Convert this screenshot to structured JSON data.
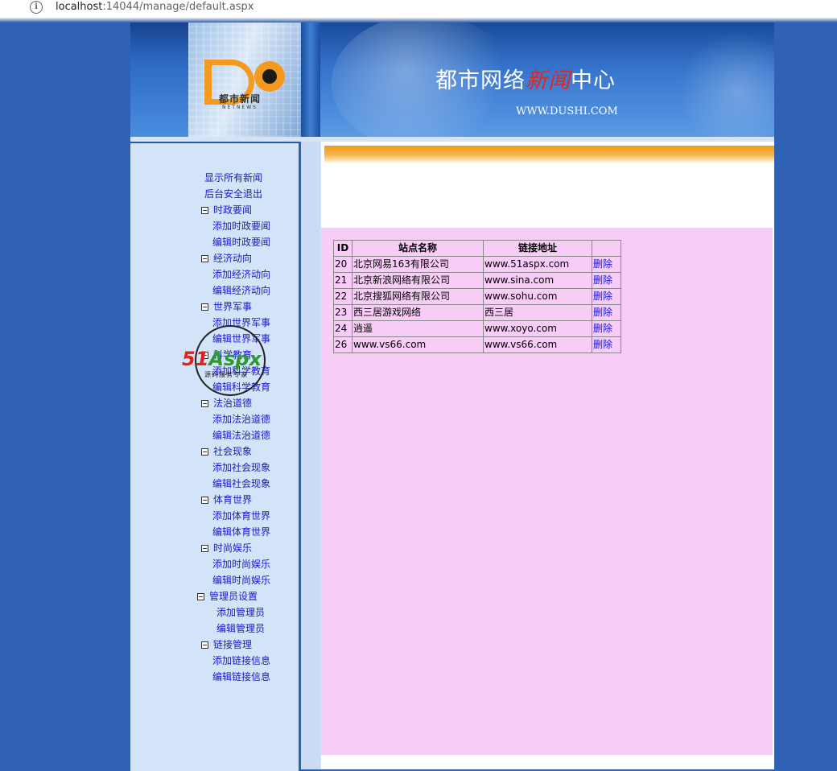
{
  "browser": {
    "url_host": "localhost",
    "url_rest": ":14044/manage/default.aspx"
  },
  "banner": {
    "logo_text": "都市新闻",
    "logo_sub": "NETNEWS",
    "title_a": "都市网络",
    "title_red": "新闻",
    "title_b": "中心",
    "site_url": "WWW.DUSHI.COM"
  },
  "nav": {
    "items": [
      {
        "label": "显示所有新闻",
        "level": "l0",
        "toggle": false
      },
      {
        "label": "后台安全退出",
        "level": "l0",
        "toggle": false
      },
      {
        "label": "时政要闻",
        "level": "l1",
        "toggle": true
      },
      {
        "label": "添加时政要闻",
        "level": "l2",
        "toggle": false
      },
      {
        "label": "编辑时政要闻",
        "level": "l2",
        "toggle": false
      },
      {
        "label": "经济动向",
        "level": "l1",
        "toggle": true
      },
      {
        "label": "添加经济动向",
        "level": "l2",
        "toggle": false
      },
      {
        "label": "编辑经济动向",
        "level": "l2",
        "toggle": false
      },
      {
        "label": "世界军事",
        "level": "l1",
        "toggle": true
      },
      {
        "label": "添加世界军事",
        "level": "l2",
        "toggle": false
      },
      {
        "label": "编辑世界军事",
        "level": "l2",
        "toggle": false
      },
      {
        "label": "科学教育",
        "level": "l1",
        "toggle": true
      },
      {
        "label": "添加科学教育",
        "level": "l2",
        "toggle": false
      },
      {
        "label": "编辑科学教育",
        "level": "l2",
        "toggle": false
      },
      {
        "label": "法治道德",
        "level": "l1",
        "toggle": true
      },
      {
        "label": "添加法治道德",
        "level": "l2",
        "toggle": false
      },
      {
        "label": "编辑法治道德",
        "level": "l2",
        "toggle": false
      },
      {
        "label": "社会现象",
        "level": "l1",
        "toggle": true
      },
      {
        "label": "添加社会现象",
        "level": "l2",
        "toggle": false
      },
      {
        "label": "编辑社会现象",
        "level": "l2",
        "toggle": false
      },
      {
        "label": "体育世界",
        "level": "l1",
        "toggle": true
      },
      {
        "label": "添加体育世界",
        "level": "l2",
        "toggle": false
      },
      {
        "label": "编辑体育世界",
        "level": "l2",
        "toggle": false
      },
      {
        "label": "时尚娱乐",
        "level": "l1",
        "toggle": true
      },
      {
        "label": "添加时尚娱乐",
        "level": "l2",
        "toggle": false
      },
      {
        "label": "编辑时尚娱乐",
        "level": "l2",
        "toggle": false
      },
      {
        "label": "管理员设置",
        "level": "l1a",
        "toggle": true
      },
      {
        "label": "添加管理员",
        "level": "l2a",
        "toggle": false
      },
      {
        "label": "编辑管理员",
        "level": "l2a",
        "toggle": false
      },
      {
        "label": "链接管理",
        "level": "l1",
        "toggle": true
      },
      {
        "label": "添加链接信息",
        "level": "l2",
        "toggle": false
      },
      {
        "label": "编辑链接信息",
        "level": "l2",
        "toggle": false
      }
    ]
  },
  "table": {
    "headers": [
      "ID",
      "站点名称",
      "链接地址",
      ""
    ],
    "rows": [
      {
        "id": "20",
        "name": "北京网易163有限公司",
        "url": "www.51aspx.com",
        "action": "删除"
      },
      {
        "id": "21",
        "name": "北京新浪网络有限公司",
        "url": "www.sina.com",
        "action": "删除"
      },
      {
        "id": "22",
        "name": "北京搜狐网络有限公司",
        "url": "www.sohu.com",
        "action": "删除"
      },
      {
        "id": "23",
        "name": "西三居游戏网络",
        "url": "西三居",
        "action": "删除"
      },
      {
        "id": "24",
        "name": "逍遥",
        "url": "www.xoyo.com",
        "action": "删除"
      },
      {
        "id": "26",
        "name": "www.vs66.com",
        "url": "www.vs66.com",
        "action": "删除"
      }
    ]
  },
  "watermark": {
    "brand_a": "51",
    "brand_b": "Aspx",
    "sub": "源码服务专家"
  },
  "colors": {
    "background": "#2f62b4",
    "nav_link": "#1a1ac8",
    "content_pink": "#f7ccf7",
    "accent_orange": "#f19a14"
  }
}
